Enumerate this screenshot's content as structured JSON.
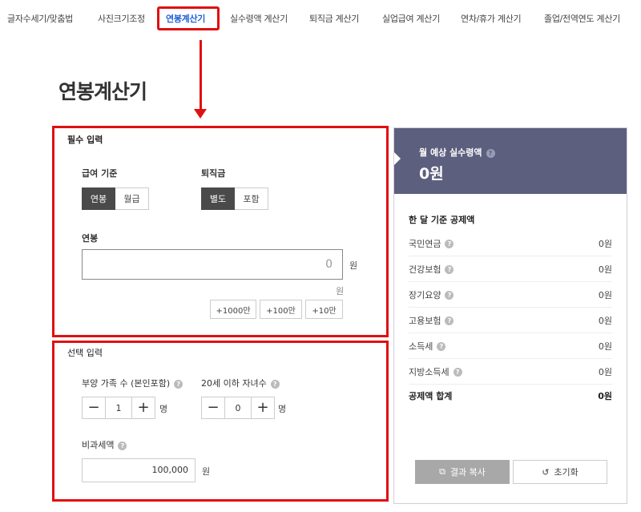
{
  "nav": {
    "items": [
      "글자수세기/맞춤법",
      "사진크기조정",
      "연봉계산기",
      "실수령액 계산기",
      "퇴직금 계산기",
      "실업급여 계산기",
      "연차/휴가 계산기",
      "졸업/전역연도 계산기"
    ],
    "active_index": 2
  },
  "page_title": "연봉계산기",
  "required": {
    "title": "필수 입력",
    "pay_basis": {
      "label": "급여 기준",
      "options": [
        "연봉",
        "월급"
      ],
      "selected": "연봉"
    },
    "severance": {
      "label": "퇴직금",
      "options": [
        "별도",
        "포함"
      ],
      "selected": "별도"
    },
    "salary": {
      "label": "연봉",
      "value": "0",
      "unit": "원",
      "sub_unit": "원"
    },
    "quick_add": [
      "+1000만",
      "+100만",
      "+10만"
    ]
  },
  "optional": {
    "title": "선택 입력",
    "dependents": {
      "label": "부양 가족 수 (본인포함)",
      "value": "1",
      "unit": "명"
    },
    "children": {
      "label": "20세 이하 자녀수",
      "value": "0",
      "unit": "명"
    },
    "nontaxable": {
      "label": "비과세액",
      "value": "100,000",
      "unit": "원"
    }
  },
  "result": {
    "monthly_label": "월 예상 실수령액",
    "monthly_amount": "0원",
    "deduction_title": "한 달 기준 공제액",
    "rows": [
      {
        "label": "국민연금",
        "value": "0원"
      },
      {
        "label": "건강보험",
        "value": "0원"
      },
      {
        "label": "장기요양",
        "value": "0원"
      },
      {
        "label": "고용보험",
        "value": "0원"
      },
      {
        "label": "소득세",
        "value": "0원"
      },
      {
        "label": "지방소득세",
        "value": "0원"
      }
    ],
    "total": {
      "label": "공제액 합계",
      "value": "0원"
    },
    "copy_button": "결과 복사",
    "reset_button": "초기화"
  },
  "colors": {
    "accent_blue": "#1f5fd8",
    "highlight_red": "#e01010",
    "result_header": "#5d5f7e",
    "segment_active": "#4a4a4a"
  },
  "icons": {
    "help": "question-circle-icon",
    "copy": "copy-icon",
    "reset": "refresh-icon",
    "minus": "minus-icon",
    "plus": "plus-icon"
  }
}
